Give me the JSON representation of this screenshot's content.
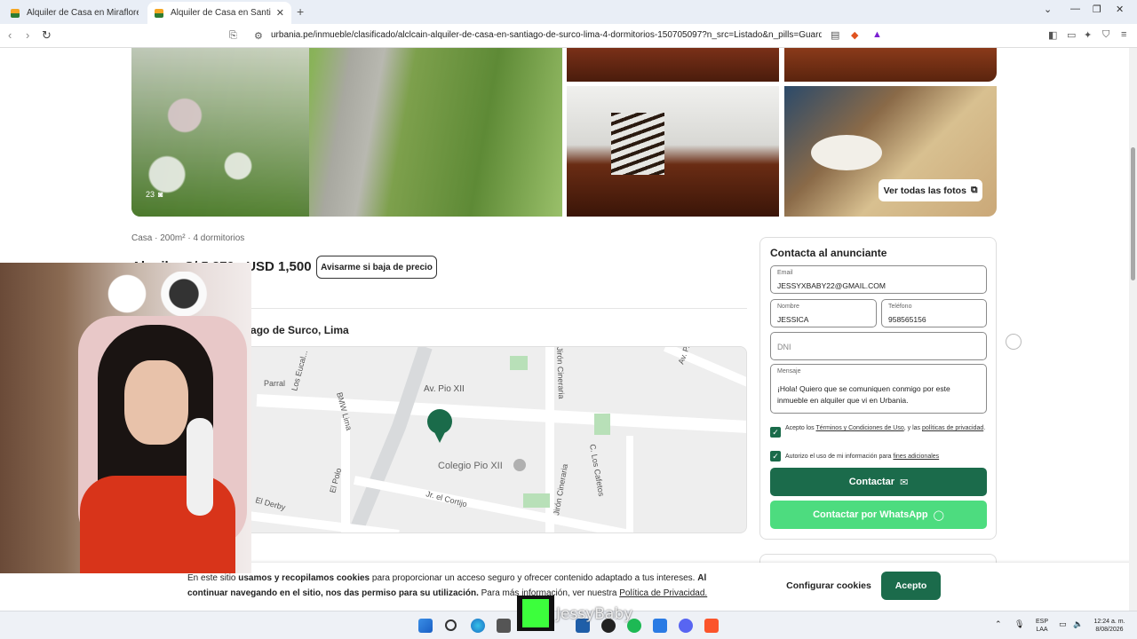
{
  "browser": {
    "tabs": [
      {
        "title": "Alquiler de Casa en Miraflores - Lima",
        "active": false
      },
      {
        "title": "Alquiler de Casa en Santiago de",
        "active": true
      }
    ],
    "url": "urbania.pe/inmueble/clasificado/alclcain-alquiler-de-casa-en-santiago-de-surco-lima-4-dormitorios-150705097?n_src=Listado&n_pills=Guardianía%...",
    "new_tab": "+"
  },
  "gallery": {
    "photo_count": "23",
    "view_all_label": "Ver todas las fotos"
  },
  "listing": {
    "meta": "Casa · 200m² · 4 dormitorios",
    "price": "Alquiler S/ 5,379 · USD 1,500",
    "price_alert_label": "Avisarme si baja de precio",
    "address": "Calle Los Cedros, Santiago de Surco, Lima"
  },
  "map": {
    "streets": [
      "Av. Pio XII",
      "C. Los Cafetos",
      "Jirón Cineraria",
      "Jirón Cineraria",
      "El Polo",
      "Jr. el Cortijo",
      "El Derby",
      "BMW Lima",
      "Los Eucal...",
      "Parral",
      "Av. P..."
    ],
    "poi": "Colegio Pio XII"
  },
  "contact": {
    "title": "Contacta al anunciante",
    "email_label": "Email",
    "email_value": "JESSYXBABY22@GMAIL.COM",
    "name_label": "Nombre",
    "name_value": "JESSICA",
    "phone_label": "Teléfono",
    "phone_value": "958565156",
    "dni_placeholder": "DNI",
    "message_label": "Mensaje",
    "message_value": "¡Hola! Quiero que se comuniquen conmigo por este inmueble en alquiler que vi en Urbania.",
    "terms_prefix": "Acepto los ",
    "terms_link": "Términos y Condiciones de Uso",
    "terms_mid": ", y las ",
    "privacy_link": "políticas de privacidad",
    "terms_suffix": ".",
    "additional_prefix": "Autorizo el uso de mi información para ",
    "additional_link": "fines adicionales",
    "contact_button": "Contactar",
    "whatsapp_button": "Contactar por WhatsApp",
    "brand_green": "#1b6b4b",
    "whatsapp_green": "#4ddc7f"
  },
  "cookies": {
    "text_1": "En este sitio ",
    "text_2": "usamos y recopilamos cookies",
    "text_3": " para proporcionar un acceso seguro y ofrecer contenido adaptado a tus intereses. ",
    "text_4": "Al continuar navegando en el sitio, nos das permiso para su utilización.",
    "text_5": " Para más información, ver nuestra ",
    "privacy_link": "Política de Privacidad.",
    "config_button": "Configurar cookies",
    "accept_button": "Acepto"
  },
  "overlay": {
    "streamer_name": "JessyBaby"
  },
  "taskbar": {
    "lang_1": "ESP",
    "lang_2": "LAA",
    "time": "12:24 a. m.",
    "date": "8/08/2026"
  }
}
